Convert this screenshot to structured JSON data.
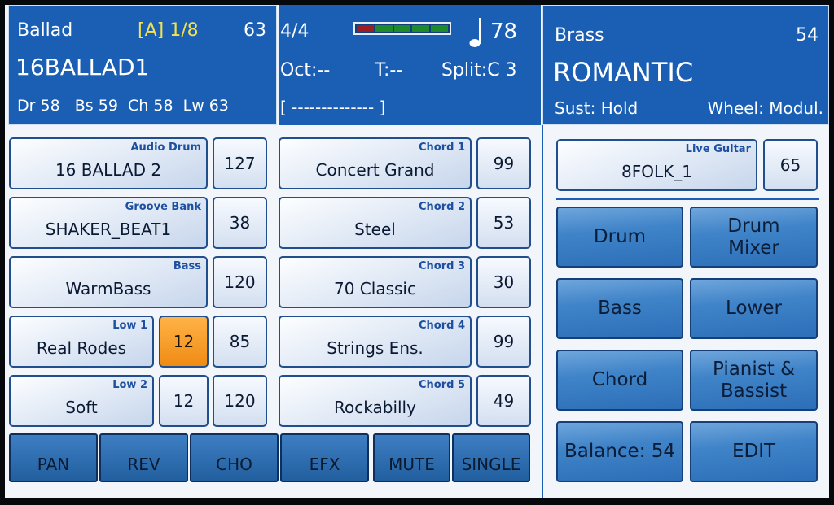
{
  "style_panel": {
    "name": "Ballad",
    "variation": "[A] 1/8",
    "number": "63",
    "style_title": "16BALLAD1",
    "volumes": "Dr 58   Bs 59  Ch 58  Lw 63"
  },
  "status": {
    "time_signature": "4/4",
    "meter_colors": [
      "#9a1e22",
      "#1f8a2a",
      "#1f8a2a",
      "#1f8a2a",
      "#1f8a2a"
    ],
    "tempo": "78",
    "octave": "Oct:--",
    "transpose": "T:--",
    "split": "Split:C 3",
    "chord_display": "[ -------------- ]"
  },
  "voice_panel": {
    "family": "Brass",
    "number": "54",
    "name": "ROMANTIC",
    "sustain": "Sust: Hold",
    "wheel": "Wheel: Modul."
  },
  "tracks": {
    "audio_drum": {
      "category": "Audio Drum",
      "name": "16 BALLAD 2",
      "value": "127"
    },
    "groove_bank": {
      "category": "Groove Bank",
      "name": "SHAKER_BEAT1",
      "value": "38"
    },
    "bass": {
      "category": "Bass",
      "name": "WarmBass",
      "value": "120"
    },
    "low1": {
      "category": "Low 1",
      "name": "Real Rodes",
      "value_a": "12",
      "value_b": "85"
    },
    "low2": {
      "category": "Low 2",
      "name": "Soft",
      "value_a": "12",
      "value_b": "120"
    },
    "chord1": {
      "category": "Chord 1",
      "name": "Concert Grand",
      "value": "99"
    },
    "chord2": {
      "category": "Chord 2",
      "name": "Steel",
      "value": "53"
    },
    "chord3": {
      "category": "Chord 3",
      "name": "70 Classic",
      "value": "30"
    },
    "chord4": {
      "category": "Chord 4",
      "name": "Strings Ens.",
      "value": "99"
    },
    "chord5": {
      "category": "Chord 5",
      "name": "Rockabilly",
      "value": "49"
    },
    "live_guitar": {
      "category": "Live Gultar",
      "name": "8FOLK_1",
      "value": "65"
    }
  },
  "mixer": {
    "drum": "Drum",
    "drum_mixer": "Drum Mixer",
    "bass": "Bass",
    "lower": "Lower",
    "chord": "Chord",
    "pianist_bassist": "Pianist & Bassist",
    "balance": "Balance: 54",
    "edit": "EDIT"
  },
  "bottom_bar": {
    "pan": "PAN",
    "rev": "REV",
    "cho": "CHO",
    "efx": "EFX",
    "mute": "MUTE",
    "single": "SINGLE"
  }
}
